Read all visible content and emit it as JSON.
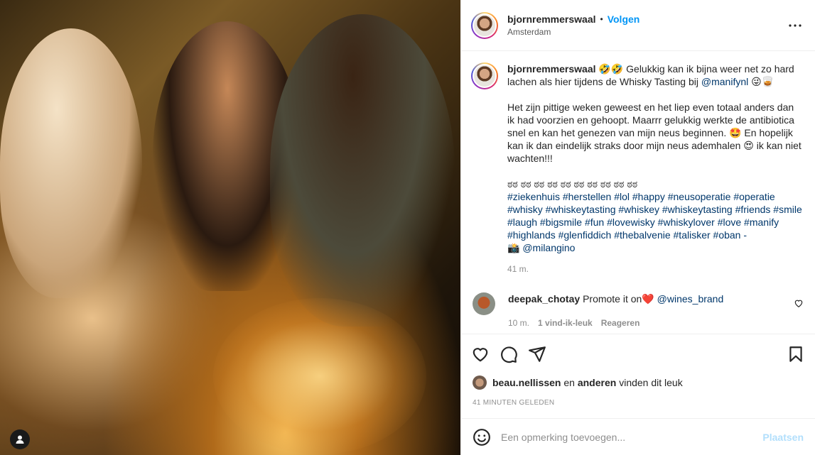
{
  "post": {
    "username": "bjornremmerswaal",
    "follow_label": "Volgen",
    "location": "Amsterdam"
  },
  "caption": {
    "username": "bjornremmerswaal",
    "line1_text": "🤣🤣 Gelukkig kan ik bijna weer net zo hard lachen als hier tijdens de Whisky Tasting bij ",
    "line1_mention": "@manifynl",
    "line1_end": " 😜🥃",
    "paragraph2": "Het zijn pittige weken geweest en het liep even totaal anders dan ik had voorzien en gehoopt. Maarrr gelukkig werkte de antibiotica snel en kan het genezen van mijn neus beginnen. 🤩 En hopelijk kan ik dan eindelijk straks door mijn neus ademhalen 😍 ik kan niet wachten!!!",
    "dots_line": "ಠಠ ಠಠ ಠಠ ಠಠ ಠಠ ಠಠ ಠಠ ಠಠ ಠಠ ಠಠ",
    "hashtags": "#ziekenhuis #herstellen #lol #happy #neusoperatie #operatie #whisky #whiskeytasting #whiskey #whiskeytasting #friends #smile #laugh #bigsmile #fun #lovewisky #whiskylover #love #manify #highlands #glenfiddich #thebalvenie #talisker #oban -",
    "photo_credit_prefix": "📸 ",
    "photo_credit": "@milangino",
    "time": "41 m."
  },
  "comment": {
    "username": "deepak_chotay",
    "text": "Promote it on❤️ ",
    "mention": "@wines_brand",
    "time": "10 m.",
    "likes": "1 vind-ik-leuk",
    "reply_label": "Reageren"
  },
  "likes_line": {
    "user": "beau.nellissen",
    "middle": " en ",
    "others": "anderen",
    "end": " vinden dit leuk"
  },
  "date_label": "41 MINUTEN GELEDEN",
  "add_comment": {
    "placeholder": "Een opmerking toevoegen...",
    "post_label": "Plaatsen"
  },
  "colors": {
    "accent": "#0095f6",
    "link": "#00376b",
    "muted": "#8e8e8e"
  }
}
